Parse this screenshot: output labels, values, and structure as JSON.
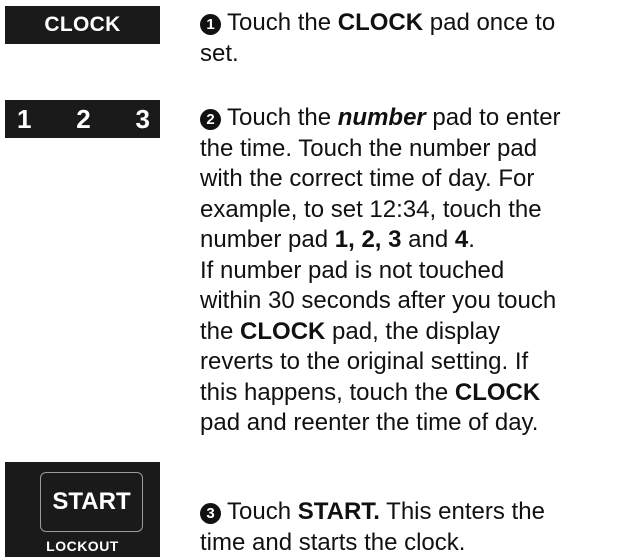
{
  "pads": {
    "clock": "CLOCK",
    "numbers": [
      "1",
      "2",
      "3"
    ],
    "start": "START",
    "lockout": "LOCKOUT"
  },
  "steps": {
    "s1": {
      "marker": "1",
      "l1_pre": "Touch the ",
      "l1_bold": "CLOCK",
      "l1_post": " pad once to",
      "l2": "set."
    },
    "s2": {
      "marker": "2",
      "l1_pre": "Touch the ",
      "l1_bi": "number",
      "l1_post": " pad to enter",
      "l2": "the time. Touch the number pad",
      "l3": "with the correct time of day. For",
      "l4": "example, to set 12:34, touch the",
      "l5_pre": "number pad ",
      "l5_bold1": "1, 2, 3",
      "l5_mid": " and ",
      "l5_bold2": "4",
      "l5_post": ".",
      "l6": "If number pad is not touched",
      "l7": "within 30 seconds after you touch",
      "l8_pre": "the ",
      "l8_bold": "CLOCK",
      "l8_post": " pad, the display",
      "l9": "reverts to the original setting. If",
      "l10_pre": "this happens, touch the ",
      "l10_bold": "CLOCK",
      "l11": "pad and reenter the time of day."
    },
    "s3": {
      "marker": "3",
      "l1_pre": "Touch ",
      "l1_bold": "START.",
      "l1_post": " This enters the",
      "l2": "time and starts the clock."
    }
  }
}
